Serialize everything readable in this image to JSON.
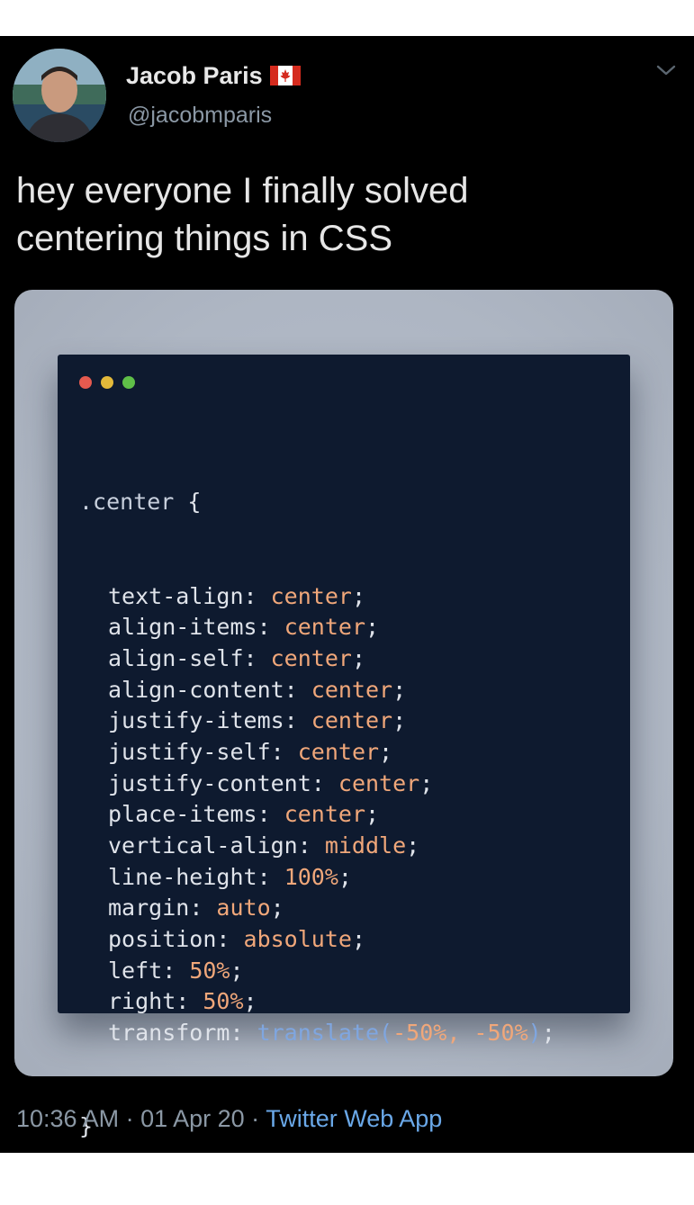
{
  "tweet": {
    "display_name": "Jacob Paris",
    "handle": "@jacobmparis",
    "text_line1": "hey everyone I finally solved",
    "text_line2": "centering things in CSS",
    "time": "10:36 AM",
    "date": "01 Apr 20",
    "separator": " · ",
    "source": "Twitter Web App",
    "flag_icon": "canada-flag-icon",
    "menu_icon": "chevron-down-icon"
  },
  "code": {
    "selector": ".center",
    "open_brace": "{",
    "close_brace": "}",
    "declarations": [
      {
        "prop": "text-align",
        "value": "center"
      },
      {
        "prop": "align-items",
        "value": "center"
      },
      {
        "prop": "align-self",
        "value": "center"
      },
      {
        "prop": "align-content",
        "value": "center"
      },
      {
        "prop": "justify-items",
        "value": "center"
      },
      {
        "prop": "justify-self",
        "value": "center"
      },
      {
        "prop": "justify-content",
        "value": "center"
      },
      {
        "prop": "place-items",
        "value": "center"
      },
      {
        "prop": "vertical-align",
        "value": "middle"
      },
      {
        "prop": "line-height",
        "value": "100%"
      },
      {
        "prop": "margin",
        "value": "auto"
      },
      {
        "prop": "position",
        "value": "absolute"
      },
      {
        "prop": "left",
        "value": "50%"
      },
      {
        "prop": "right",
        "value": "50%"
      },
      {
        "prop": "transform",
        "fn": "translate",
        "args": "-50%, -50%"
      }
    ]
  },
  "colors": {
    "background": "#000000",
    "editor_bg": "#0e1a2f",
    "value": "#f0a77a",
    "function": "#7fa6e0",
    "link": "#6aa8e8"
  }
}
